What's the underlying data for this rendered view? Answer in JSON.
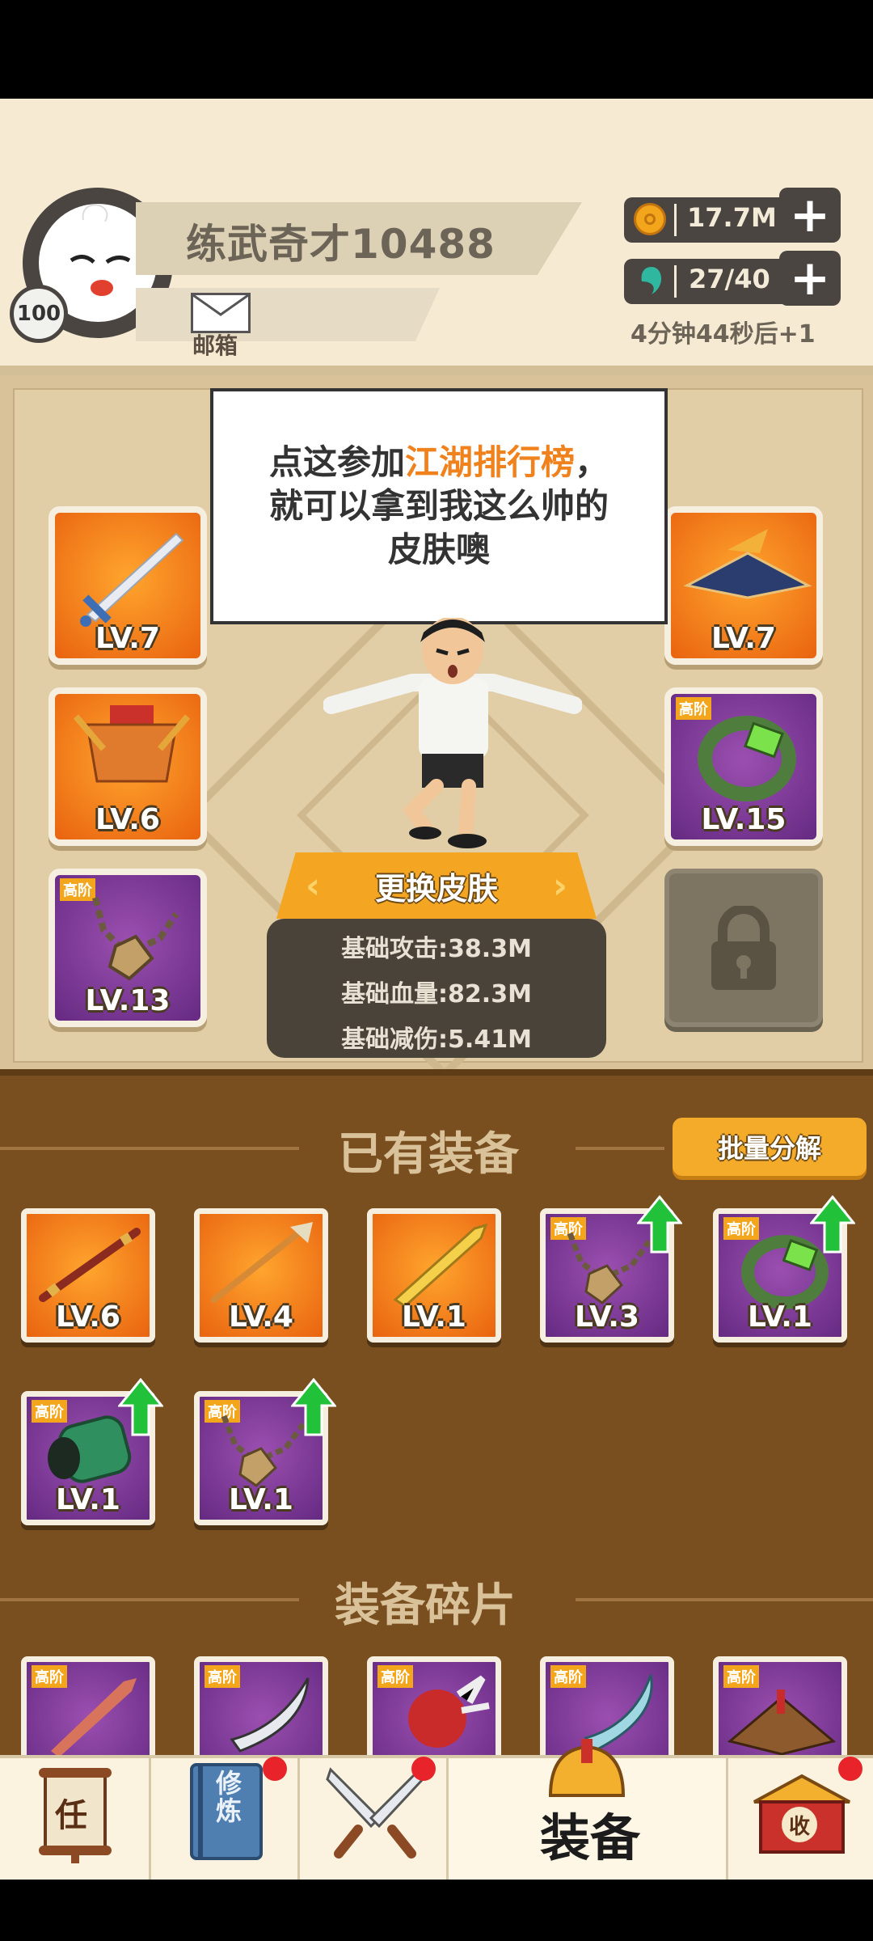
{
  "header": {
    "player_name": "练武奇才10488",
    "level": "100",
    "mailbox_label": "邮箱",
    "coins": "17.7M",
    "stamina": "27/40",
    "stamina_timer": "4分钟44秒后+1"
  },
  "speech": {
    "prefix": "点这参加",
    "highlight": "江湖排行榜",
    "suffix_line1": "，",
    "line2": "就可以拿到我这么帅的",
    "line3": "皮肤噢"
  },
  "equipped": {
    "left": [
      {
        "icon": "sword-icon",
        "grade": "",
        "level": "LV.7"
      },
      {
        "icon": "armor-icon",
        "grade": "",
        "level": "LV.6"
      },
      {
        "icon": "necklace-icon",
        "grade": "高阶",
        "level": "LV.13"
      }
    ],
    "right": [
      {
        "icon": "straw-hat-icon",
        "grade": "",
        "level": "LV.7"
      },
      {
        "icon": "bracelet-icon",
        "grade": "高阶",
        "level": "LV.15"
      },
      {
        "icon": "lock-icon",
        "grade": "",
        "level": ""
      }
    ]
  },
  "change_skin_label": "更换皮肤",
  "stats": {
    "attack": "基础攻击:38.3M",
    "hp": "基础血量:82.3M",
    "damage_reduction": "基础减伤:5.41M"
  },
  "inventory": {
    "title": "已有装备",
    "bulk_decompose_label": "批量分解",
    "items": [
      {
        "icon": "staff-icon",
        "grade": "",
        "level": "LV.6",
        "color": "orange",
        "upgrade": false
      },
      {
        "icon": "spear-icon",
        "grade": "",
        "level": "LV.4",
        "color": "orange",
        "upgrade": false
      },
      {
        "icon": "blade-icon",
        "grade": "",
        "level": "LV.1",
        "color": "orange",
        "upgrade": false
      },
      {
        "icon": "necklace-icon",
        "grade": "高阶",
        "level": "LV.3",
        "color": "purple",
        "upgrade": true
      },
      {
        "icon": "bracelet-icon",
        "grade": "高阶",
        "level": "LV.1",
        "color": "purple",
        "upgrade": true
      },
      {
        "icon": "bracer-icon",
        "grade": "高阶",
        "level": "LV.1",
        "color": "purple",
        "upgrade": true
      },
      {
        "icon": "necklace-icon",
        "grade": "高阶",
        "level": "LV.1",
        "color": "purple",
        "upgrade": true
      }
    ]
  },
  "fragments": {
    "title": "装备碎片",
    "items": [
      {
        "icon": "sword-fragment-icon",
        "grade": "高阶"
      },
      {
        "icon": "saber-fragment-icon",
        "grade": "高阶"
      },
      {
        "icon": "mace-fragment-icon",
        "grade": "高阶"
      },
      {
        "icon": "scimitar-fragment-icon",
        "grade": "高阶"
      },
      {
        "icon": "hat-fragment-icon",
        "grade": "高阶"
      }
    ]
  },
  "bottom_nav": {
    "quest_glyph": "任",
    "training_glyph1": "修",
    "training_glyph2": "炼",
    "equipment_label": "装备",
    "collect_glyph": "收"
  },
  "colors": {
    "accent_orange": "#f4a623",
    "purple_grade": "#652a82",
    "orange_grade": "#e9630f",
    "highlight_text": "#f0821e",
    "upgrade_green": "#22c13a",
    "notification_red": "#e8242a"
  }
}
